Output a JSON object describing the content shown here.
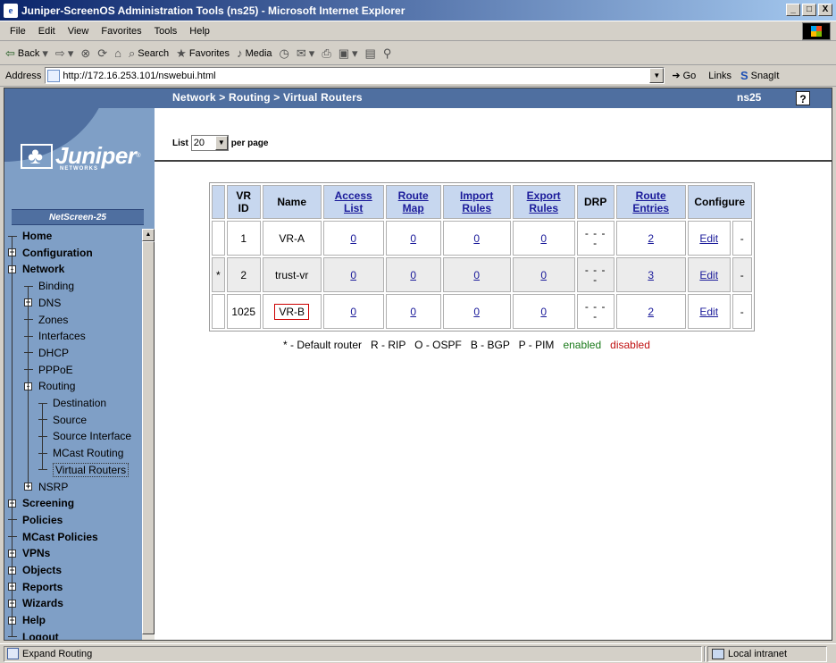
{
  "window": {
    "title": "Juniper-ScreenOS Administration Tools (ns25) - Microsoft Internet Explorer",
    "controls": [
      "_",
      "□",
      "X"
    ]
  },
  "menu": [
    "File",
    "Edit",
    "View",
    "Favorites",
    "Tools",
    "Help"
  ],
  "toolbar": {
    "back": "Back",
    "search": "Search",
    "favorites": "Favorites",
    "media": "Media"
  },
  "address": {
    "label": "Address",
    "url": "http://172.16.253.101/nswebui.html",
    "go": "Go",
    "links": "Links",
    "snagit": "SnagIt"
  },
  "banner": {
    "breadcrumb": "Network > Routing > Virtual Routers",
    "device": "ns25",
    "help": "?"
  },
  "sidebar": {
    "logo": "Juniper",
    "logo_sub": "NETWORKS",
    "model": "NetScreen-25",
    "items": [
      {
        "label": "Home",
        "level": 0,
        "expander": ""
      },
      {
        "label": "Configuration",
        "level": 0,
        "expander": "+"
      },
      {
        "label": "Network",
        "level": 0,
        "expander": "-"
      },
      {
        "label": "Binding",
        "level": 1,
        "expander": ""
      },
      {
        "label": "DNS",
        "level": 1,
        "expander": "+"
      },
      {
        "label": "Zones",
        "level": 1,
        "expander": ""
      },
      {
        "label": "Interfaces",
        "level": 1,
        "expander": ""
      },
      {
        "label": "DHCP",
        "level": 1,
        "expander": ""
      },
      {
        "label": "PPPoE",
        "level": 1,
        "expander": ""
      },
      {
        "label": "Routing",
        "level": 1,
        "expander": "-"
      },
      {
        "label": "Destination",
        "level": 2,
        "expander": ""
      },
      {
        "label": "Source",
        "level": 2,
        "expander": ""
      },
      {
        "label": "Source Interface",
        "level": 2,
        "expander": ""
      },
      {
        "label": "MCast Routing",
        "level": 2,
        "expander": ""
      },
      {
        "label": "Virtual Routers",
        "level": 2,
        "expander": ""
      },
      {
        "label": "NSRP",
        "level": 1,
        "expander": "+"
      },
      {
        "label": "Screening",
        "level": 0,
        "expander": "+"
      },
      {
        "label": "Policies",
        "level": 0,
        "expander": ""
      },
      {
        "label": "MCast Policies",
        "level": 0,
        "expander": ""
      },
      {
        "label": "VPNs",
        "level": 0,
        "expander": "+"
      },
      {
        "label": "Objects",
        "level": 0,
        "expander": "+"
      },
      {
        "label": "Reports",
        "level": 0,
        "expander": "+"
      },
      {
        "label": "Wizards",
        "level": 0,
        "expander": "+"
      },
      {
        "label": "Help",
        "level": 0,
        "expander": "+"
      },
      {
        "label": "Logout",
        "level": 0,
        "expander": ""
      }
    ]
  },
  "list": {
    "label": "List",
    "value": "20",
    "suffix": "per page"
  },
  "table": {
    "headers": [
      "VR ID",
      "Name",
      "Access List",
      "Route Map",
      "Import Rules",
      "Export Rules",
      "DRP",
      "Route Entries",
      "Configure"
    ],
    "rows": [
      {
        "flag": "",
        "id": "1",
        "name": "VR-A",
        "access": "0",
        "map": "0",
        "import": "0",
        "export": "0",
        "drp": "- - - -",
        "routes": "2",
        "edit": "Edit",
        "extra": "-"
      },
      {
        "flag": "*",
        "id": "2",
        "name": "trust-vr",
        "access": "0",
        "map": "0",
        "import": "0",
        "export": "0",
        "drp": "- - - -",
        "routes": "3",
        "edit": "Edit",
        "extra": "-"
      },
      {
        "flag": "",
        "id": "1025",
        "name": "VR-B",
        "access": "0",
        "map": "0",
        "import": "0",
        "export": "0",
        "drp": "- - - -",
        "routes": "2",
        "edit": "Edit",
        "extra": "-"
      }
    ]
  },
  "legend": {
    "text": "* - Default router   R - RIP   O - OSPF   B - BGP   P - PIM",
    "enabled": "enabled",
    "disabled": "disabled"
  },
  "status": {
    "text": "Expand Routing",
    "zone": "Local intranet"
  }
}
